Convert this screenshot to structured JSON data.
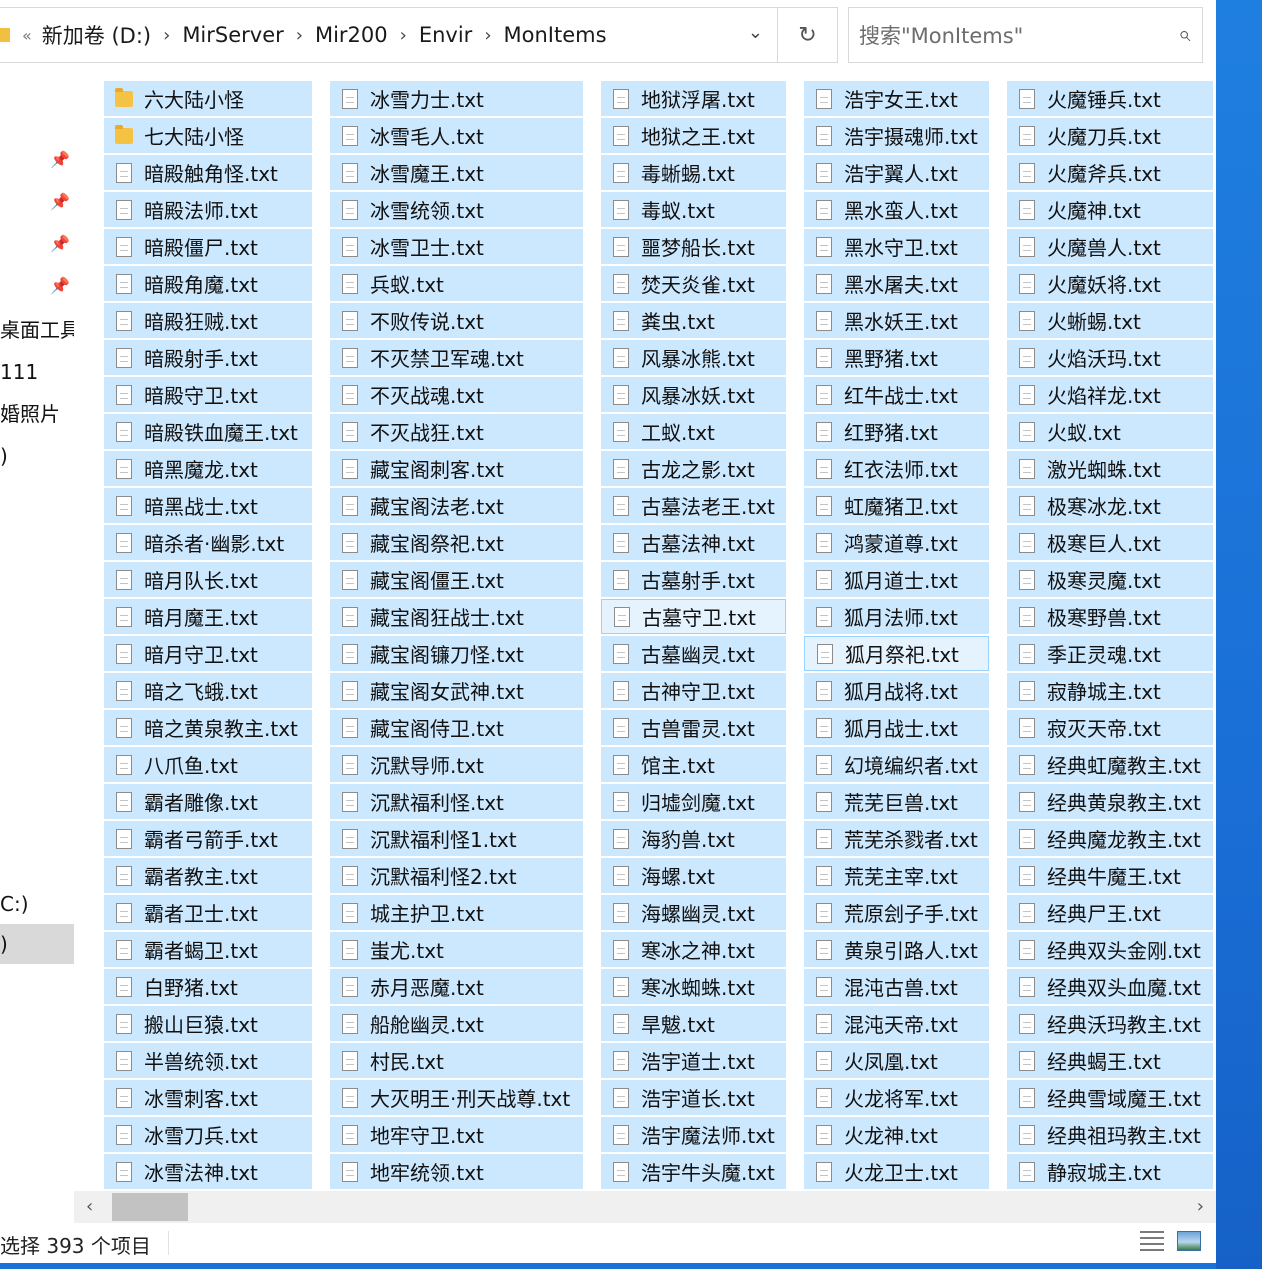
{
  "address": {
    "back_glyph": "«",
    "crumbs": [
      "新加卷 (D:)",
      "MirServer",
      "Mir200",
      "Envir",
      "MonItems"
    ],
    "separator": "›",
    "dropdown_glyph": "⌄",
    "refresh_glyph": "↻"
  },
  "search": {
    "placeholder": "搜索\"MonItems\"",
    "icon": "search-icon"
  },
  "nav": {
    "items": [
      "桌面工具",
      "111",
      "婚照片",
      ")",
      "C:)",
      ")"
    ],
    "pin_glyph": "📌"
  },
  "files": {
    "columns": [
      [
        "六大陆小怪",
        "七大陆小怪",
        "暗殿触角怪.txt",
        "暗殿法师.txt",
        "暗殿僵尸.txt",
        "暗殿角魔.txt",
        "暗殿狂贼.txt",
        "暗殿射手.txt",
        "暗殿守卫.txt",
        "暗殿铁血魔王.txt",
        "暗黑魔龙.txt",
        "暗黑战士.txt",
        "暗杀者·幽影.txt",
        "暗月队长.txt",
        "暗月魔王.txt",
        "暗月守卫.txt",
        "暗之飞蛾.txt",
        "暗之黄泉教主.txt",
        "八爪鱼.txt",
        "霸者雕像.txt",
        "霸者弓箭手.txt",
        "霸者教主.txt",
        "霸者卫士.txt",
        "霸者蝎卫.txt",
        "白野猪.txt",
        "搬山巨猿.txt",
        "半兽统领.txt",
        "冰雪刺客.txt",
        "冰雪刀兵.txt",
        "冰雪法神.txt"
      ],
      [
        "冰雪力士.txt",
        "冰雪毛人.txt",
        "冰雪魔王.txt",
        "冰雪统领.txt",
        "冰雪卫士.txt",
        "兵蚁.txt",
        "不败传说.txt",
        "不灭禁卫军魂.txt",
        "不灭战魂.txt",
        "不灭战狂.txt",
        "藏宝阁刺客.txt",
        "藏宝阁法老.txt",
        "藏宝阁祭祀.txt",
        "藏宝阁僵王.txt",
        "藏宝阁狂战士.txt",
        "藏宝阁镰刀怪.txt",
        "藏宝阁女武神.txt",
        "藏宝阁侍卫.txt",
        "沉默导师.txt",
        "沉默福利怪.txt",
        "沉默福利怪1.txt",
        "沉默福利怪2.txt",
        "城主护卫.txt",
        "蚩尤.txt",
        "赤月恶魔.txt",
        "船舱幽灵.txt",
        "村民.txt",
        "大灭明王·刑天战尊.txt",
        "地牢守卫.txt",
        "地牢统领.txt"
      ],
      [
        "地狱浮屠.txt",
        "地狱之王.txt",
        "毒蜥蜴.txt",
        "毒蚁.txt",
        "噩梦船长.txt",
        "焚天炎雀.txt",
        "粪虫.txt",
        "风暴冰熊.txt",
        "风暴冰妖.txt",
        "工蚁.txt",
        "古龙之影.txt",
        "古墓法老王.txt",
        "古墓法神.txt",
        "古墓射手.txt",
        "古墓守卫.txt",
        "古墓幽灵.txt",
        "古神守卫.txt",
        "古兽雷灵.txt",
        "馆主.txt",
        "归墟剑魔.txt",
        "海豹兽.txt",
        "海螺.txt",
        "海螺幽灵.txt",
        "寒冰之神.txt",
        "寒冰蜘蛛.txt",
        "旱魃.txt",
        "浩宇道士.txt",
        "浩宇道长.txt",
        "浩宇魔法师.txt",
        "浩宇牛头魔.txt"
      ],
      [
        "浩宇女王.txt",
        "浩宇摄魂师.txt",
        "浩宇翼人.txt",
        "黑水蛮人.txt",
        "黑水守卫.txt",
        "黑水屠夫.txt",
        "黑水妖王.txt",
        "黑野猪.txt",
        "红牛战士.txt",
        "红野猪.txt",
        "红衣法师.txt",
        "虹魔猪卫.txt",
        "鸿蒙道尊.txt",
        "狐月道士.txt",
        "狐月法师.txt",
        "狐月祭祀.txt",
        "狐月战将.txt",
        "狐月战士.txt",
        "幻境编织者.txt",
        "荒芜巨兽.txt",
        "荒芜杀戮者.txt",
        "荒芜主宰.txt",
        "荒原刽子手.txt",
        "黄泉引路人.txt",
        "混沌古兽.txt",
        "混沌天帝.txt",
        "火凤凰.txt",
        "火龙将军.txt",
        "火龙神.txt",
        "火龙卫士.txt"
      ],
      [
        "火魔锤兵.txt",
        "火魔刀兵.txt",
        "火魔斧兵.txt",
        "火魔神.txt",
        "火魔兽人.txt",
        "火魔妖将.txt",
        "火蜥蜴.txt",
        "火焰沃玛.txt",
        "火焰祥龙.txt",
        "火蚁.txt",
        "激光蜘蛛.txt",
        "极寒冰龙.txt",
        "极寒巨人.txt",
        "极寒灵魔.txt",
        "极寒野兽.txt",
        "季正灵魂.txt",
        "寂静城主.txt",
        "寂灭天帝.txt",
        "经典虹魔教主.txt",
        "经典黄泉教主.txt",
        "经典魔龙教主.txt",
        "经典牛魔王.txt",
        "经典尸王.txt",
        "经典双头金刚.txt",
        "经典双头血魔.txt",
        "经典沃玛教主.txt",
        "经典蝎王.txt",
        "经典雪域魔王.txt",
        "经典祖玛教主.txt",
        "静寂城主.txt"
      ]
    ]
  },
  "scrollbar": {
    "left_glyph": "‹",
    "right_glyph": "›"
  },
  "status": {
    "text": "选择 393 个项目"
  }
}
